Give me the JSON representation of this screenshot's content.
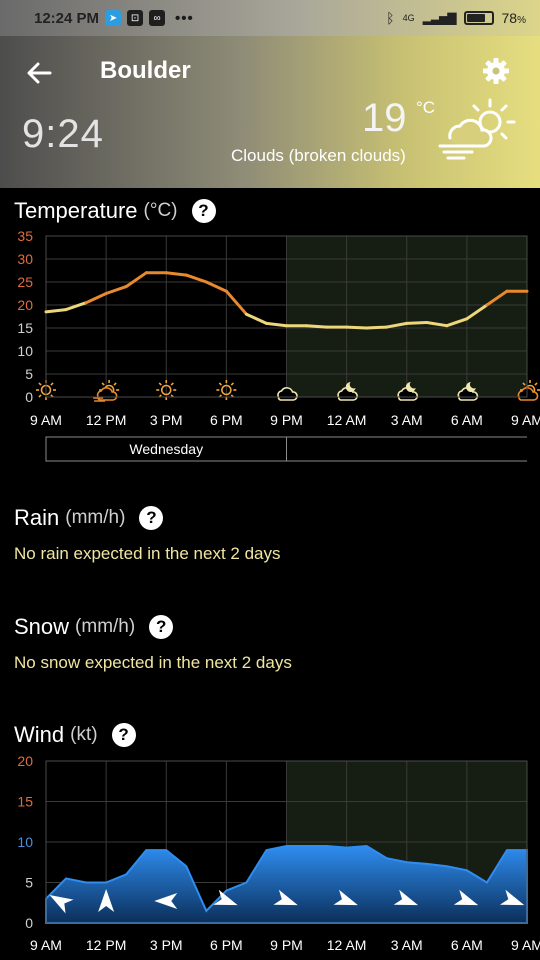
{
  "status_bar": {
    "time": "12:24 PM",
    "icons": [
      "telegram-icon",
      "lock-icon",
      "infinity-icon"
    ],
    "more": "•••",
    "network": "4G",
    "battery": "78",
    "battery_level": 0.78
  },
  "header": {
    "city": "Boulder",
    "local_time": "9:24",
    "current_temp": "19",
    "unit": "°C",
    "condition": "Clouds (broken clouds)",
    "colors": {
      "gradient_left": "#4d4d4d",
      "gradient_right": "#e6de7f"
    }
  },
  "temperature": {
    "title": "Temperature",
    "unit": "(°C)",
    "day_label": "Wednesday",
    "chart_data": {
      "type": "line",
      "y_ticks": [
        "35",
        "30",
        "25",
        "20",
        "15",
        "10",
        "5",
        "0"
      ],
      "ylim": [
        0,
        35
      ],
      "x_labels": [
        "9 AM",
        "12 PM",
        "3 PM",
        "6 PM",
        "9 PM",
        "12 AM",
        "3 AM",
        "6 AM",
        "9 AM"
      ],
      "x": [
        0,
        1,
        2,
        3,
        4,
        5,
        6,
        7,
        8,
        9,
        10,
        11,
        12,
        13,
        14,
        15,
        16,
        17,
        18,
        19,
        20,
        21,
        22,
        23,
        24
      ],
      "values": [
        18.5,
        19,
        20.5,
        22.5,
        24,
        27,
        27,
        26.5,
        25,
        23,
        18,
        16,
        15.5,
        15.5,
        15.2,
        15.2,
        15,
        15.2,
        16,
        16.2,
        15.5,
        17,
        20,
        23,
        23
      ],
      "icons": [
        "sun",
        "sun-cloud-wind",
        "sun",
        "sun",
        "cloud",
        "cloud-moon",
        "cloud-moon",
        "cloud-moon",
        "sun-cloud"
      ],
      "colors": {
        "warm": "#e8892e",
        "cool": "#ecd77a",
        "grid": "#3a3a3a",
        "night": "#161d12"
      },
      "night_start": 12,
      "grid": true
    }
  },
  "rain": {
    "title": "Rain",
    "unit": "(mm/h)",
    "note": "No rain expected in the next 2 days"
  },
  "snow": {
    "title": "Snow",
    "unit": "(mm/h)",
    "note": "No snow expected in the next 2 days"
  },
  "wind": {
    "title": "Wind",
    "unit": "(kt)",
    "chart_data": {
      "type": "area",
      "y_ticks": [
        "20",
        "15",
        "10",
        "5",
        "0"
      ],
      "ylim": [
        0,
        20
      ],
      "x_labels": [
        "9 AM",
        "12 PM",
        "3 PM",
        "6 PM",
        "9 PM",
        "12 AM",
        "3 AM",
        "6 AM",
        "9 AM"
      ],
      "x": [
        0,
        1,
        2,
        3,
        4,
        5,
        6,
        7,
        8,
        9,
        10,
        11,
        12,
        13,
        14,
        15,
        16,
        17,
        18,
        19,
        20,
        21,
        22,
        23,
        24
      ],
      "values": [
        3,
        5.5,
        5,
        5,
        6,
        9,
        9,
        7,
        1.5,
        4,
        5,
        9,
        9.5,
        9.5,
        9.5,
        9.3,
        9.5,
        8,
        7.5,
        7.3,
        7,
        6.5,
        5,
        9,
        9
      ],
      "direction_arrows": [
        "nw",
        "n",
        "e",
        "se",
        "se",
        "se",
        "se",
        "se",
        "se"
      ],
      "colors": {
        "fill": "#2a7fdc",
        "line": "#2f8df0",
        "grid": "#3a3a3a",
        "night": "#161d12"
      },
      "night_start": 12,
      "grid": true
    }
  }
}
